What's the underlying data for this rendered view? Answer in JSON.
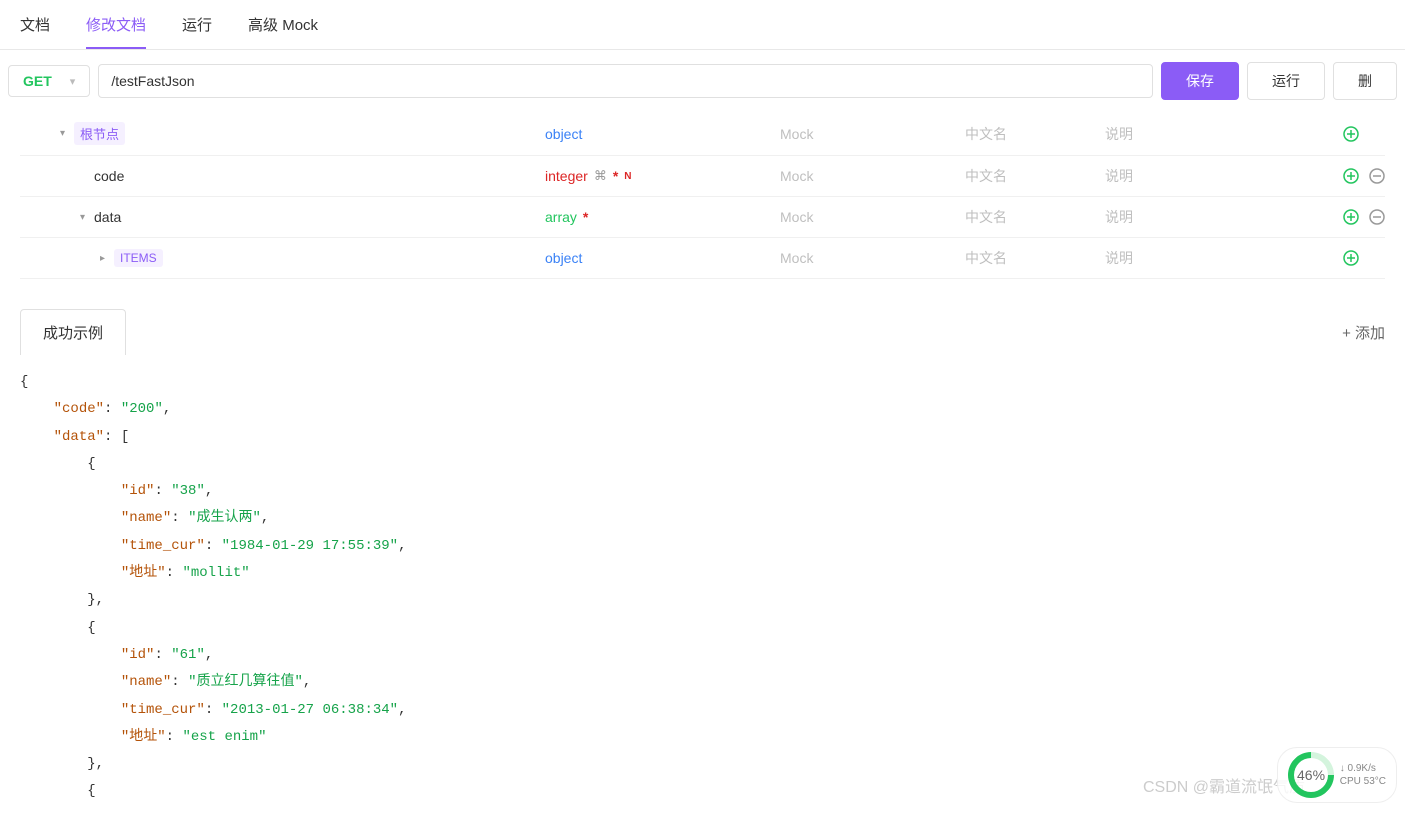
{
  "tabs": {
    "items": [
      {
        "label": "文档",
        "active": false
      },
      {
        "label": "修改文档",
        "active": true
      },
      {
        "label": "运行",
        "active": false
      },
      {
        "label": "高级 Mock",
        "active": false
      }
    ]
  },
  "request": {
    "method": "GET",
    "url": "/testFastJson",
    "saveLabel": "保存",
    "runLabel": "运行",
    "deleteLabel": "删"
  },
  "schema": {
    "mockPlaceholder": "Mock",
    "cnamePlaceholder": "中文名",
    "descPlaceholder": "说明",
    "rows": [
      {
        "indent": 1,
        "expand": "▾",
        "nameBadge": "根节点",
        "type": "object",
        "typeClass": "type-object",
        "addOnly": true
      },
      {
        "indent": 2,
        "expand": "",
        "name": "code",
        "type": "integer",
        "typeClass": "type-integer",
        "hasLink": true,
        "required": true,
        "hasN": true,
        "addRemove": true
      },
      {
        "indent": 2,
        "expand": "▾",
        "name": "data",
        "type": "array",
        "typeClass": "type-array",
        "required": true,
        "addRemove": true
      },
      {
        "indent": 3,
        "expand": "▸",
        "nameBadge": "ITEMS",
        "type": "object",
        "typeClass": "type-object",
        "addOnly": true
      }
    ]
  },
  "example": {
    "tabLabel": "成功示例",
    "addLabel": "+ 添加",
    "json": {
      "code": "200",
      "data": [
        {
          "id": "38",
          "name": "成生认两",
          "time_cur": "1984-01-29 17:55:39",
          "地址": "mollit"
        },
        {
          "id": "61",
          "name": "质立红几算往值",
          "time_cur": "2013-01-27 06:38:34",
          "地址": "est enim"
        }
      ]
    }
  },
  "watermark": "CSDN @霸道流氓气质",
  "sysinfo": {
    "gauge": "46%",
    "netdown": "0.9K/s",
    "cpu": "CPU 53°C"
  }
}
